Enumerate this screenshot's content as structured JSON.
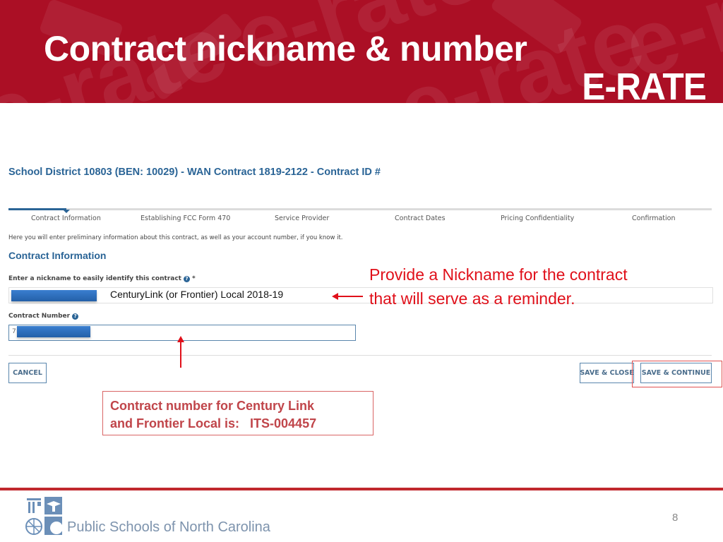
{
  "slide": {
    "title": "Contract nickname & number",
    "brand_logo": "E-RATE",
    "banner_watermark": "e-rate",
    "page_number": "8",
    "footer_org": "Public Schools of North Carolina"
  },
  "colors": {
    "banner": "#ab0f25",
    "annotation_red": "#e0101a",
    "portal_blue": "#2a6496",
    "footer_rule": "#c0282d"
  },
  "form": {
    "header": "School District 10803 (BEN: 10029) - WAN Contract 1819-2122 - Contract ID #",
    "steps": [
      {
        "label": "Contract Information",
        "active": true
      },
      {
        "label": "Establishing FCC Form 470",
        "active": false
      },
      {
        "label": "Service Provider",
        "active": false
      },
      {
        "label": "Contract Dates",
        "active": false
      },
      {
        "label": "Pricing Confidentiality",
        "active": false
      },
      {
        "label": "Confirmation",
        "active": false
      }
    ],
    "intro": "Here you will enter preliminary information about this contract, as well as your account number, if you know it.",
    "section_title": "Contract Information",
    "nickname": {
      "label": "Enter a nickname to easily identify this contract",
      "required_mark": "*",
      "value": "CenturyLink (or Frontier) Local 2018-19"
    },
    "contract_number": {
      "label": "Contract Number",
      "value_prefix": "7"
    },
    "help_icon": "?",
    "buttons": {
      "cancel": "CANCEL",
      "save_close": "SAVE & CLOSE",
      "save_continue": "SAVE & CONTINUE"
    }
  },
  "annotations": {
    "nickname_note": [
      "Provide a Nickname for the contract",
      "that will serve as a reminder."
    ],
    "callout": [
      "Contract number for Century Link",
      "and Frontier Local is:   ITS-004457"
    ]
  }
}
